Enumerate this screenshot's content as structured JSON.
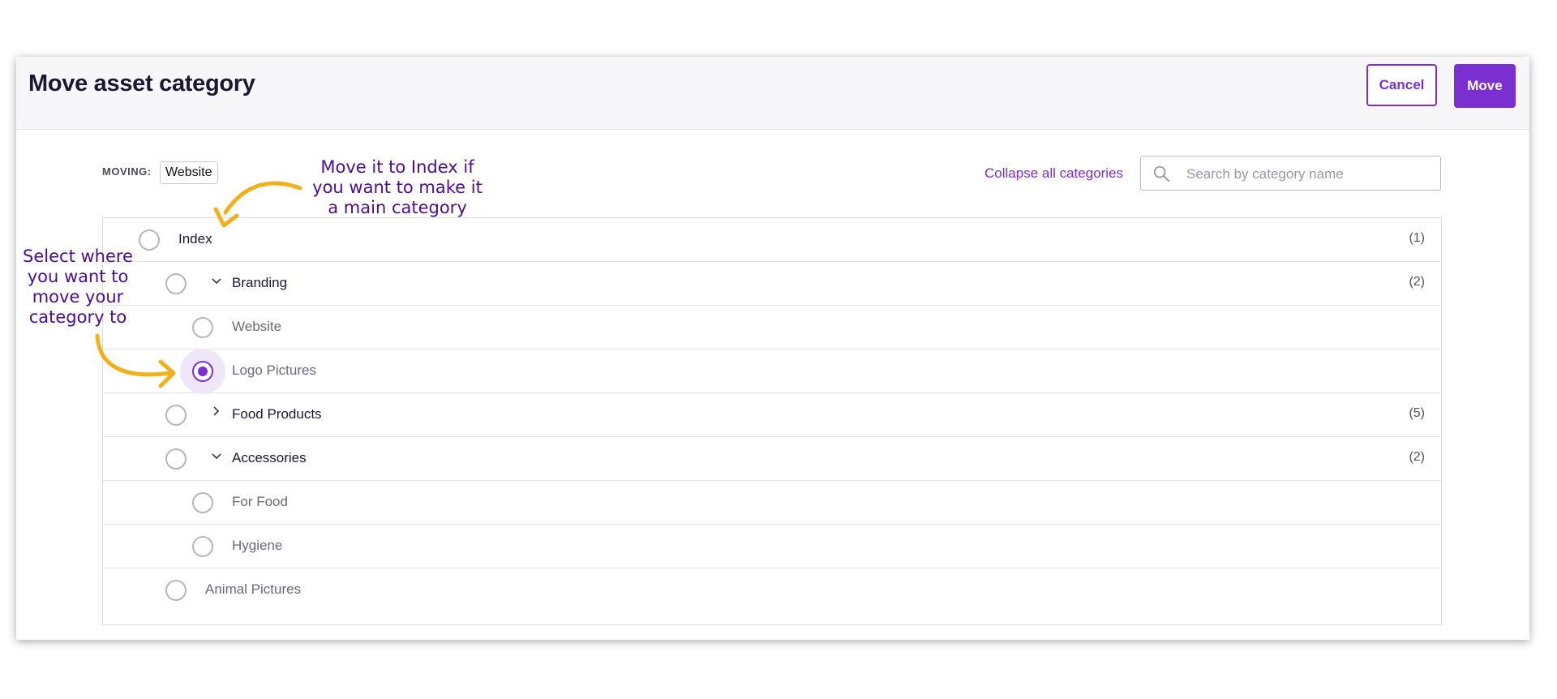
{
  "header": {
    "title": "Move asset category",
    "cancel_label": "Cancel",
    "move_label": "Move"
  },
  "toolbar": {
    "moving_label": "MOVING:",
    "moving_value": "Website",
    "collapse_label": "Collapse all categories",
    "search_placeholder": "Search by category name"
  },
  "tree": {
    "rows": [
      {
        "label": "Index",
        "count": "(1)",
        "selected": false
      },
      {
        "label": "Branding",
        "count": "(2)",
        "expanded": true
      },
      {
        "label": "Website",
        "count": ""
      },
      {
        "label": "Logo Pictures",
        "count": "",
        "selected": true
      },
      {
        "label": "Food Products",
        "count": "(5)",
        "expanded": false
      },
      {
        "label": "Accessories",
        "count": "(2)",
        "expanded": true
      },
      {
        "label": "For Food",
        "count": ""
      },
      {
        "label": "Hygiene",
        "count": ""
      },
      {
        "label": "Animal Pictures",
        "count": ""
      }
    ]
  },
  "annotations": {
    "index_note": [
      "Move it to Index if",
      "you want to make it",
      "a main category"
    ],
    "select_note": [
      "Select where",
      "you want to",
      "move your",
      "category to"
    ]
  },
  "colors": {
    "accent": "#7b2fd0",
    "annotation_text": "#4a0e8f",
    "annotation_arrow": "#f0b11a"
  }
}
